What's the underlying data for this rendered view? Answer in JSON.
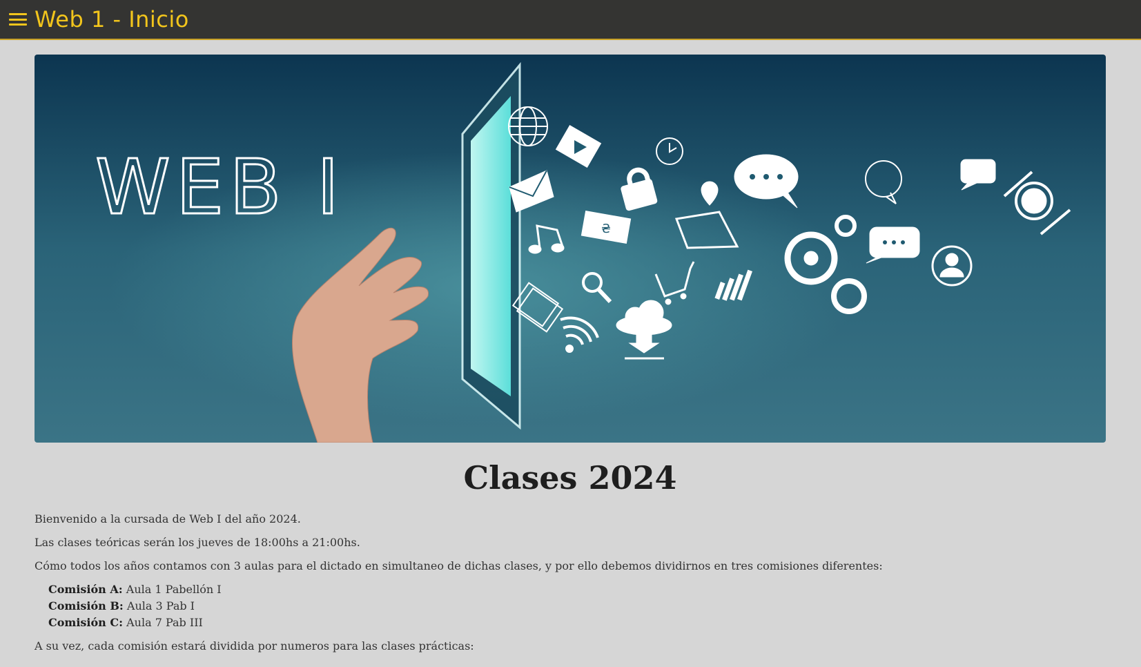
{
  "header": {
    "menu_icon": "hamburger-menu-icon",
    "title": "Web 1 - Inicio",
    "accent": "#f2c51c",
    "background": "#343432"
  },
  "banner": {
    "text": "WEB I",
    "icons": [
      "globe-icon",
      "film-icon",
      "clock-icon",
      "mail-icon",
      "padlock-icon",
      "speech-bubble-icon",
      "phone-bubble-icon",
      "chat-icon",
      "cutlery-icon",
      "music-note-icon",
      "banknote-icon",
      "map-pin-icon",
      "gears-icon",
      "user-icon",
      "magnifier-icon",
      "cart-icon",
      "bar-chart-icon",
      "document-icon",
      "wifi-icon",
      "cloud-download-icon"
    ]
  },
  "main": {
    "title": "Clases 2024",
    "p1": "Bienvenido a la cursada de Web I del año 2024.",
    "p2": "Las clases teóricas serán los jueves de 18:00hs a 21:00hs.",
    "p3": "Cómo todos los años contamos con 3 aulas para el dictado en simultaneo de dichas clases, y por ello debemos dividirnos en tres comisiones diferentes:",
    "comisiones": [
      {
        "label": "Comisión A:",
        "value": " Aula 1 Pabellón I"
      },
      {
        "label": "Comisión B:",
        "value": " Aula 3 Pab I"
      },
      {
        "label": "Comisión C:",
        "value": " Aula 7 Pab III"
      }
    ],
    "p4": "A su vez, cada comisión estará dividida por numeros para las clases prácticas:"
  }
}
